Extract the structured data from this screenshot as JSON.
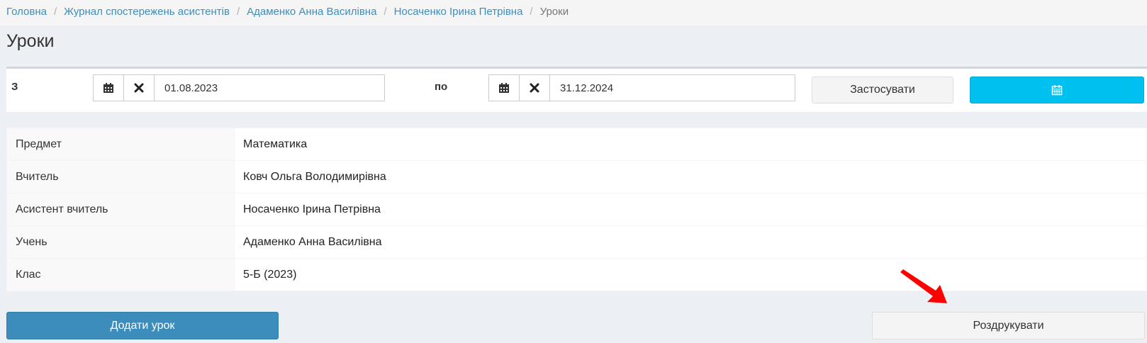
{
  "breadcrumb": {
    "items": [
      "Головна",
      "Журнал спостережень асистентів",
      "Адаменко Анна Василівна",
      "Носаченко Ірина Петрівна"
    ],
    "current": "Уроки",
    "separator": "/"
  },
  "page": {
    "title": "Уроки"
  },
  "filter": {
    "from_label": "З",
    "from_value": "01.08.2023",
    "to_label": "по",
    "to_value": "31.12.2024",
    "apply_label": "Застосувати",
    "calendar_icon": "calendar-icon",
    "clear_icon": "times-icon"
  },
  "info": {
    "rows": [
      {
        "label": "Предмет",
        "value": "Математика"
      },
      {
        "label": "Вчитель",
        "value": "Ковч Ольга Володимирівна"
      },
      {
        "label": "Асистент вчитель",
        "value": "Носаченко Ірина Петрівна"
      },
      {
        "label": "Учень",
        "value": "Адаменко Анна Василівна"
      },
      {
        "label": "Клас",
        "value": "5-Б (2023)"
      }
    ]
  },
  "actions": {
    "add_label": "Додати урок",
    "print_label": "Роздрукувати"
  },
  "colors": {
    "primary": "#3c8dbc",
    "info": "#00c0ef",
    "annotation_arrow": "#ff0000"
  }
}
